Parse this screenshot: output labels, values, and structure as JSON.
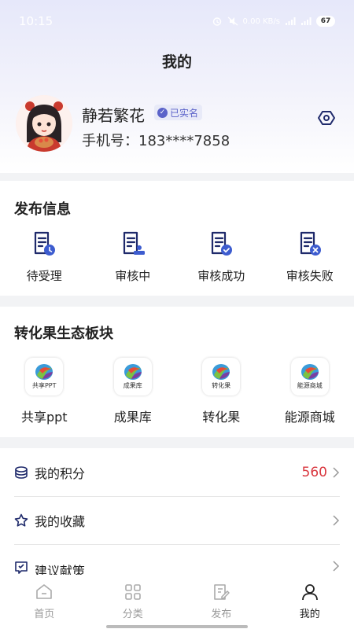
{
  "status_bar": {
    "time": "10:15",
    "network": "0.00 KB/s",
    "battery": "67"
  },
  "header": {
    "title": "我的"
  },
  "profile": {
    "name": "静若繁花",
    "verified_label": "已实名",
    "phone": "手机号：183****7858"
  },
  "publish_info": {
    "title": "发布信息",
    "items": [
      {
        "label": "待受理",
        "icon": "doc-clock-icon"
      },
      {
        "label": "审核中",
        "icon": "doc-stamp-icon"
      },
      {
        "label": "审核成功",
        "icon": "doc-check-icon"
      },
      {
        "label": "审核失败",
        "icon": "doc-x-icon"
      }
    ]
  },
  "ecosystem": {
    "title": "转化果生态板块",
    "items": [
      {
        "tile_text": "共享PPT",
        "label": "共享ppt"
      },
      {
        "tile_text": "成果库",
        "label": "成果库"
      },
      {
        "tile_text": "转化果",
        "label": "转化果"
      },
      {
        "tile_text": "能源商城",
        "label": "能源商城"
      }
    ]
  },
  "menu": [
    {
      "label": "我的积分",
      "value": "560",
      "icon": "coins-icon"
    },
    {
      "label": "我的收藏",
      "value": "",
      "icon": "star-icon"
    },
    {
      "label": "建议献策",
      "value": "",
      "icon": "feedback-icon"
    }
  ],
  "tab_bar": {
    "tabs": [
      {
        "label": "首页",
        "icon": "home-icon"
      },
      {
        "label": "分类",
        "icon": "grid-icon"
      },
      {
        "label": "发布",
        "icon": "edit-icon"
      },
      {
        "label": "我的",
        "icon": "user-icon"
      }
    ],
    "active": "我的"
  },
  "colors": {
    "accent": "#5b63c9",
    "points": "#d9363e"
  }
}
